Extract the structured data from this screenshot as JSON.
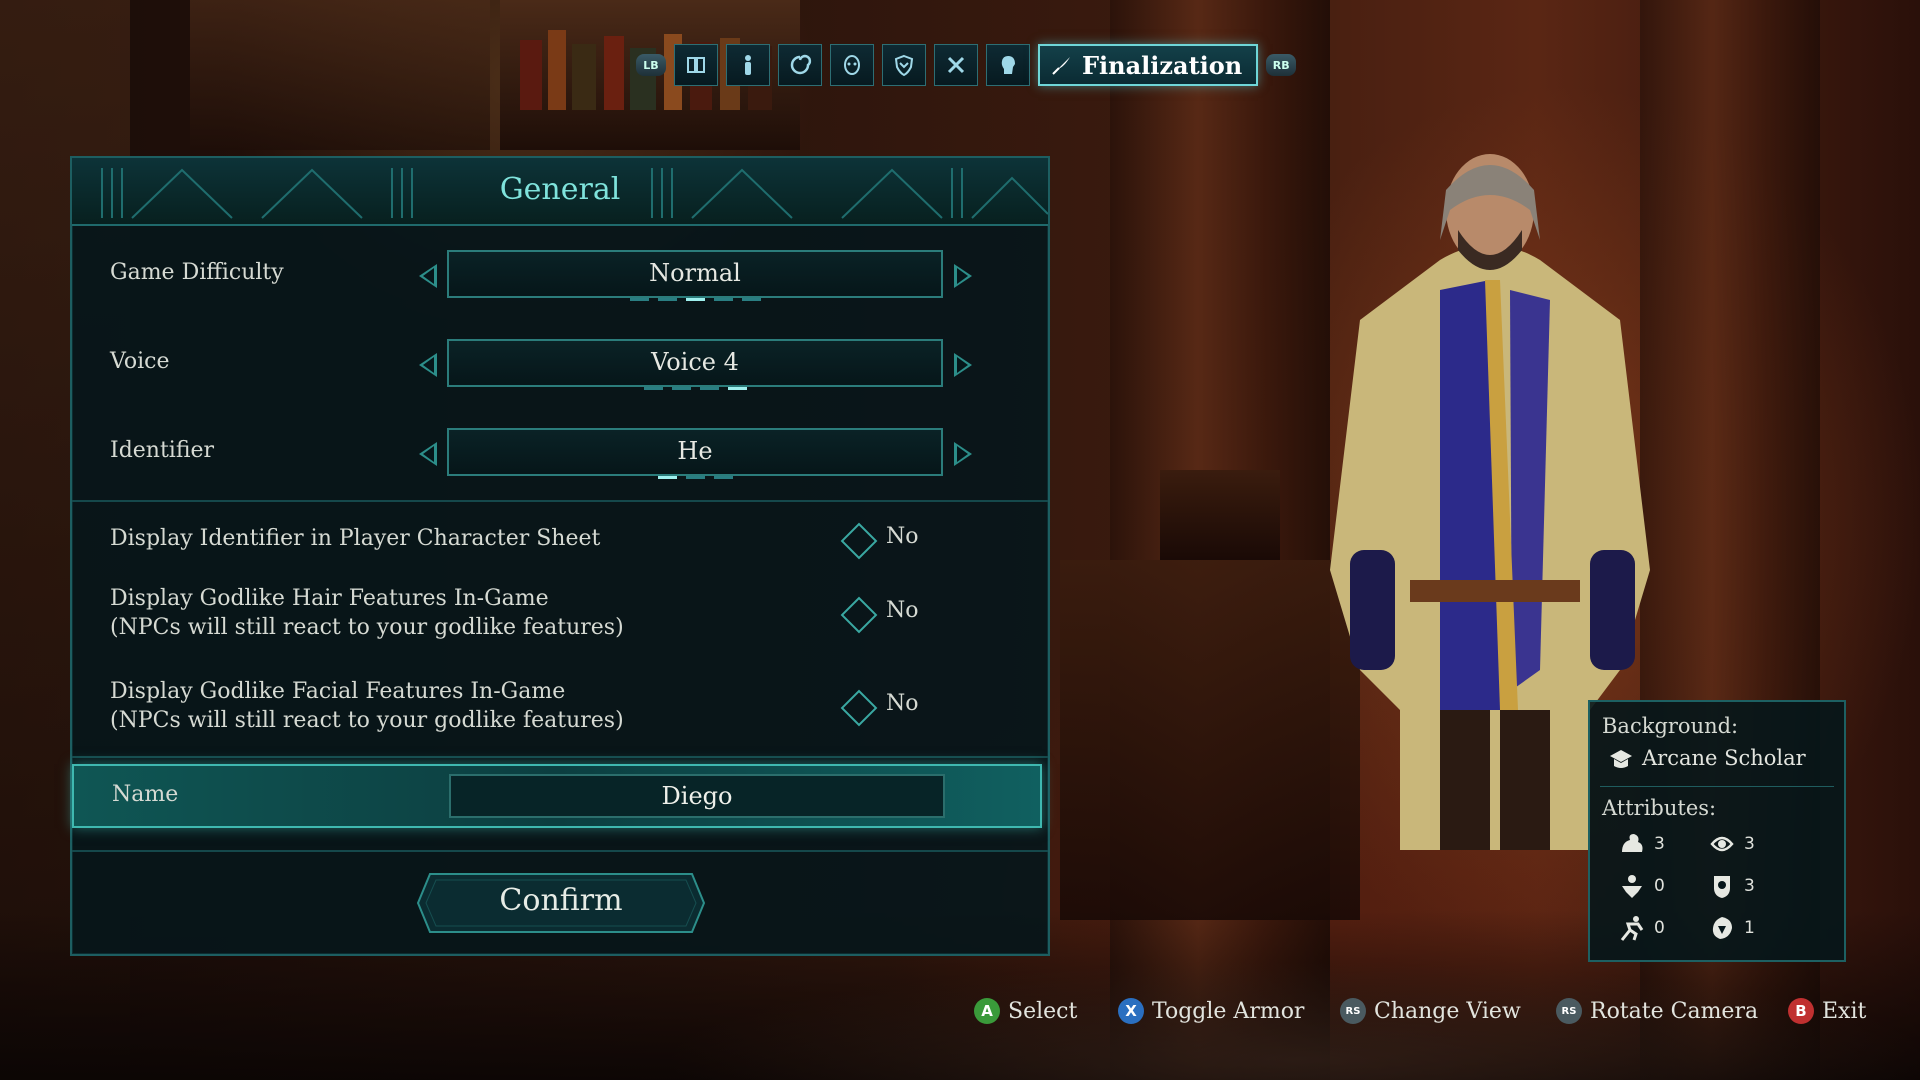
{
  "tab_bar": {
    "left_bumper": "LB",
    "right_bumper": "RB",
    "tabs": [
      {
        "icon": "cards-icon"
      },
      {
        "icon": "figure-icon"
      },
      {
        "icon": "swirl-icon"
      },
      {
        "icon": "mask-icon"
      },
      {
        "icon": "shield-icon"
      },
      {
        "icon": "tools-icon"
      },
      {
        "icon": "head-icon"
      }
    ],
    "active_tab": {
      "icon": "quill-icon",
      "label": "Finalization"
    }
  },
  "panel": {
    "title": "General",
    "settings": {
      "difficulty": {
        "label": "Game Difficulty",
        "value": "Normal",
        "option_count": 5,
        "selected_index": 2
      },
      "voice": {
        "label": "Voice",
        "value": "Voice 4",
        "option_count": 4,
        "selected_index": 3
      },
      "identifier": {
        "label": "Identifier",
        "value": "He",
        "option_count": 3,
        "selected_index": 0
      }
    },
    "toggles": {
      "display_identifier": {
        "label": "Display Identifier in Player Character Sheet",
        "value": "No"
      },
      "hair_features": {
        "label": "Display Godlike Hair Features In-Game",
        "sub": "(NPCs will still react to your godlike features)",
        "value": "No"
      },
      "facial_features": {
        "label": "Display Godlike Facial Features In-Game",
        "sub": "(NPCs will still react to your godlike features)",
        "value": "No"
      }
    },
    "name": {
      "label": "Name",
      "value": "Diego"
    },
    "confirm_label": "Confirm"
  },
  "info_card": {
    "background_heading": "Background:",
    "background_value": "Arcane Scholar",
    "attributes_heading": "Attributes:",
    "attributes": [
      {
        "icon": "might-icon",
        "value": "3"
      },
      {
        "icon": "intellect-icon",
        "value": "3"
      },
      {
        "icon": "constitution-icon",
        "value": "0"
      },
      {
        "icon": "perception-icon",
        "value": "3"
      },
      {
        "icon": "dexterity-icon",
        "value": "0"
      },
      {
        "icon": "resolve-icon",
        "value": "1"
      }
    ]
  },
  "hints": {
    "select": {
      "button": "A",
      "label": "Select"
    },
    "toggle_armor": {
      "button": "X",
      "label": "Toggle Armor"
    },
    "change_view": {
      "button": "RS",
      "label": "Change View"
    },
    "rotate_camera": {
      "button": "RS",
      "label": "Rotate Camera"
    },
    "exit": {
      "button": "B",
      "label": "Exit"
    }
  },
  "colors": {
    "accent": "#6fd6d8",
    "panel_bg": "#06161a",
    "border": "#1d5e61",
    "button_a": "#3a9a3a",
    "button_x": "#2a6fc0",
    "button_b": "#c03030"
  }
}
